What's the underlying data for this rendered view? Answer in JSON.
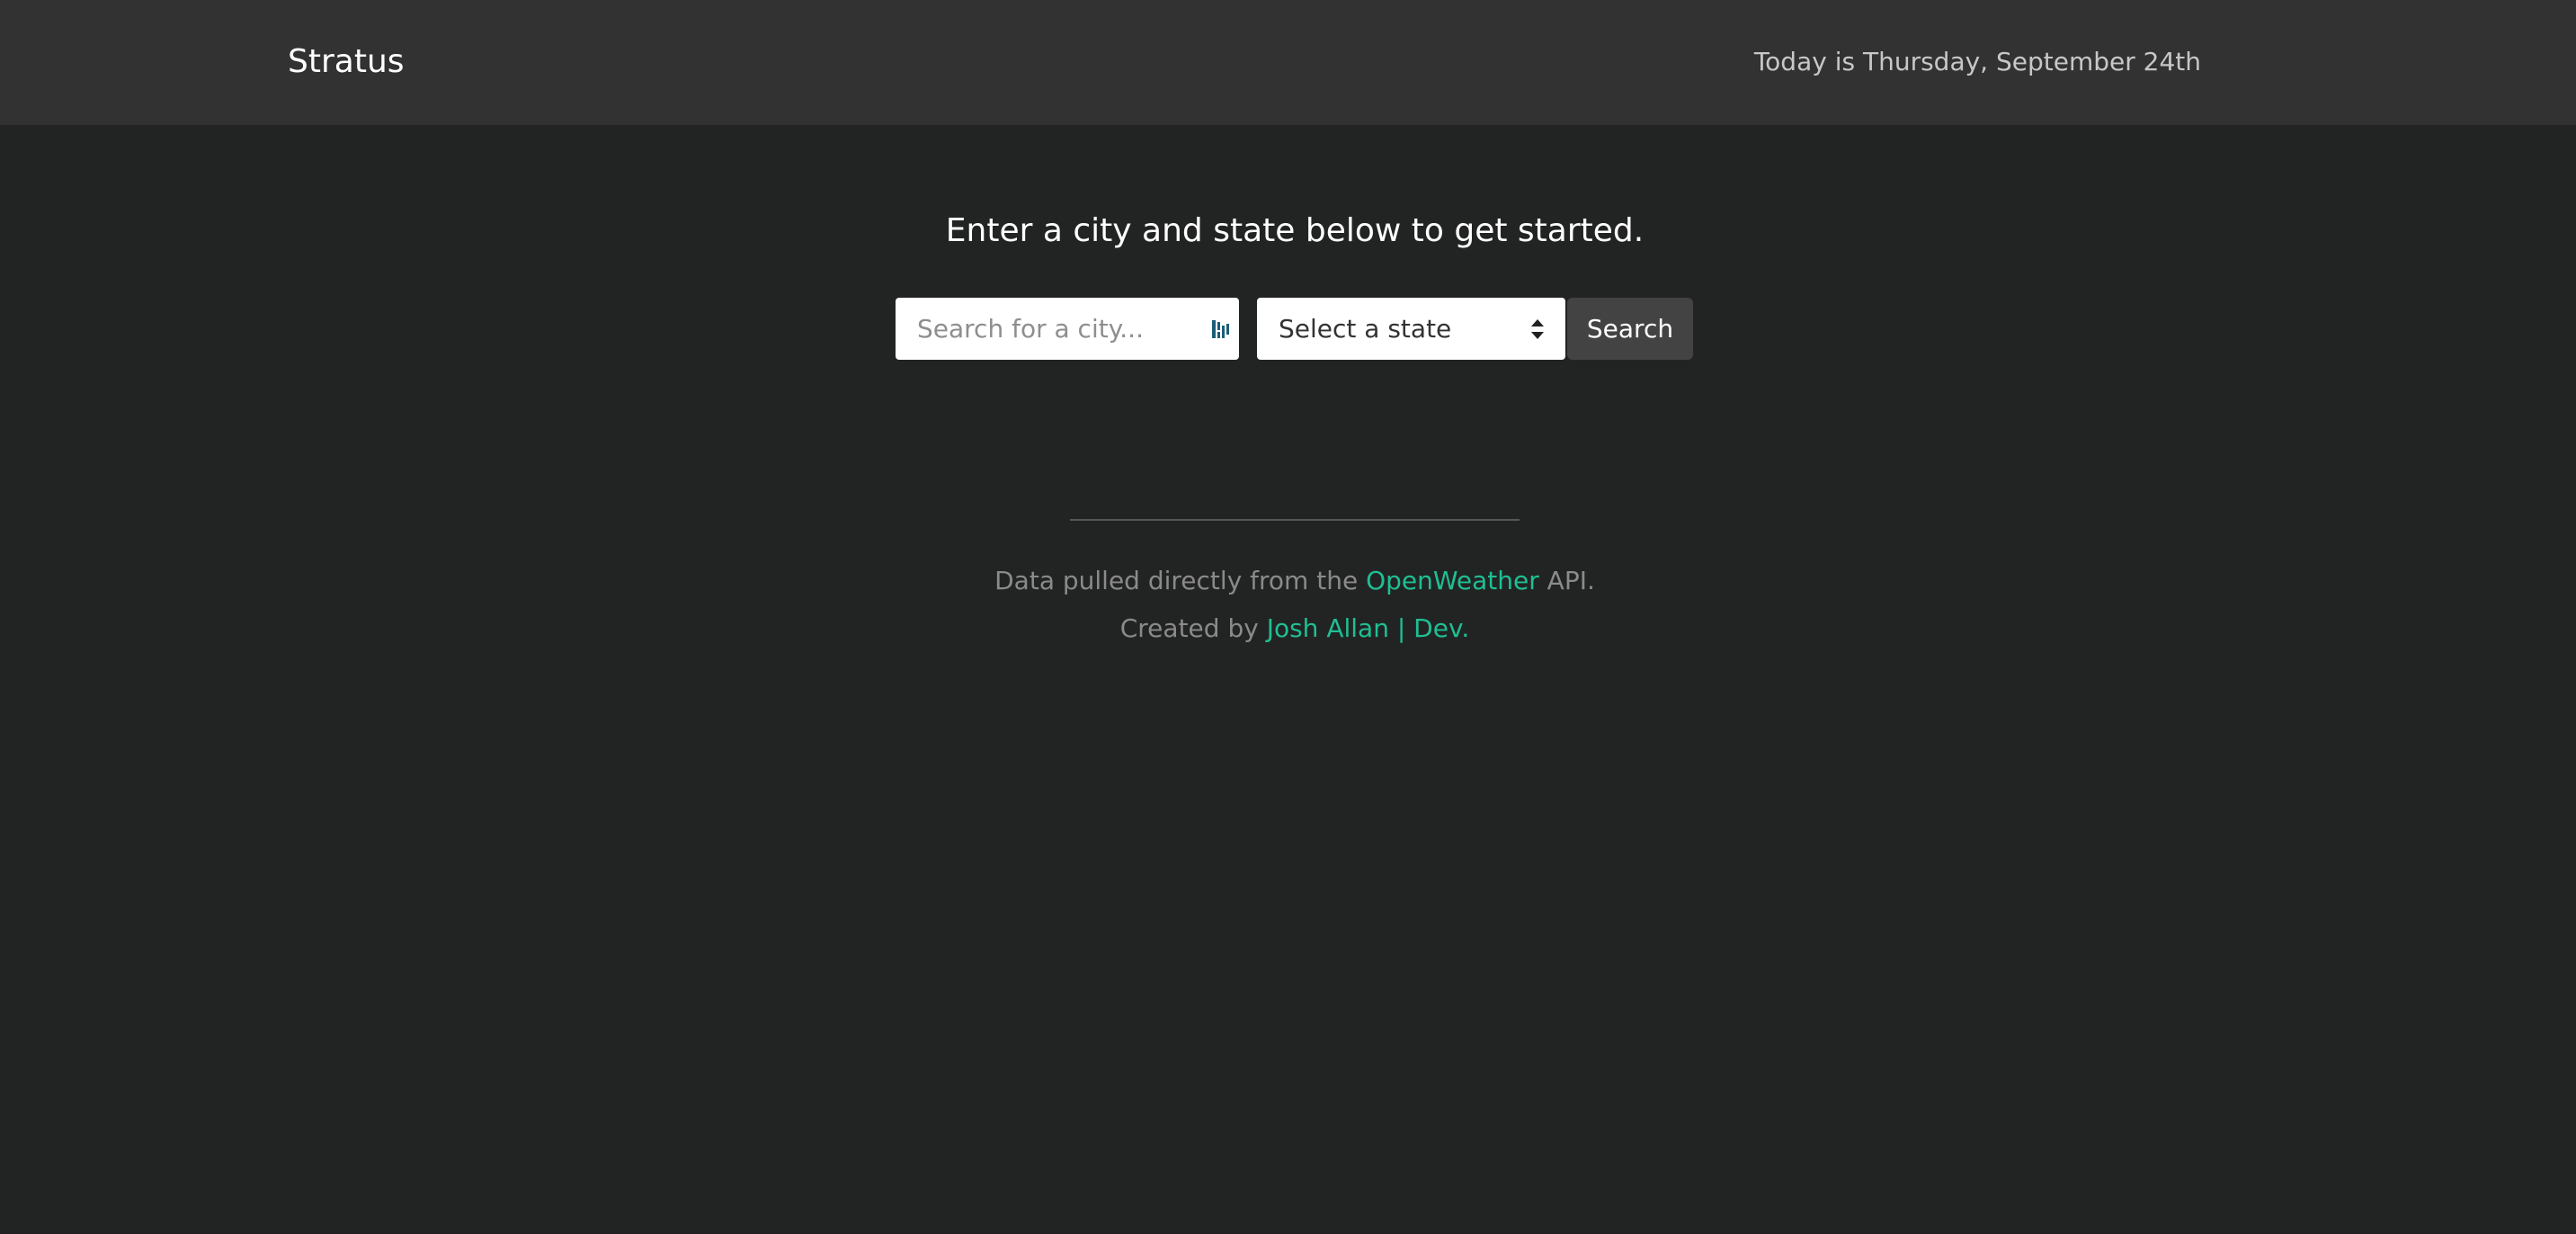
{
  "navbar": {
    "brand": "Stratus",
    "date_text": "Today is Thursday, September 24th"
  },
  "main": {
    "headline": "Enter a city and state below to get started.",
    "city_input": {
      "placeholder": "Search for a city...",
      "value": ""
    },
    "state_select": {
      "selected": "Select a state"
    },
    "search_button": "Search"
  },
  "footer": {
    "line1_prefix": "Data pulled directly from the ",
    "line1_link": "OpenWeather",
    "line1_suffix": " API.",
    "line2_prefix": "Created by ",
    "line2_link": "Josh Allan | Dev."
  },
  "colors": {
    "background": "#222423",
    "navbar": "#323232",
    "accent_link": "#1fbf93",
    "button": "#434343"
  },
  "icons": {
    "input_extension": "password-manager-icon",
    "select_arrow": "up-down-arrows-icon"
  }
}
